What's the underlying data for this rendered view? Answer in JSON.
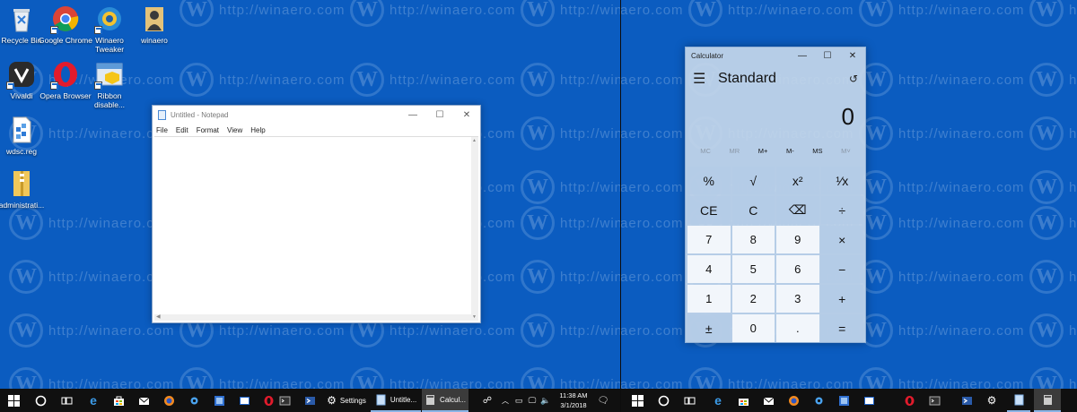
{
  "desktop_icons": [
    {
      "name": "recycle-bin",
      "label": "Recycle Bin"
    },
    {
      "name": "google-chrome",
      "label": "Google Chrome"
    },
    {
      "name": "winaero-tweaker",
      "label": "Winaero Tweaker"
    },
    {
      "name": "winaero",
      "label": "winaero"
    },
    {
      "name": "vivaldi",
      "label": "Vivaldi"
    },
    {
      "name": "opera-browser",
      "label": "Opera Browser"
    },
    {
      "name": "ribbon-disable",
      "label": "Ribbon disable..."
    },
    {
      "name": "wdsc-reg",
      "label": "wdsc.reg"
    },
    {
      "name": "administrati",
      "label": "administrati..."
    }
  ],
  "watermark": {
    "letter": "W",
    "text": "http://winaero.com"
  },
  "notepad": {
    "title": "Untitled - Notepad",
    "menu": [
      "File",
      "Edit",
      "Format",
      "View",
      "Help"
    ],
    "controls": {
      "minimize": "—",
      "maximize": "☐",
      "close": "✕"
    }
  },
  "calculator": {
    "title": "Calculator",
    "mode": "Standard",
    "display": "0",
    "controls": {
      "minimize": "—",
      "maximize": "☐",
      "close": "✕"
    },
    "menu_glyph": "☰",
    "history_glyph": "↺",
    "memory": [
      {
        "label": "MC",
        "enabled": false
      },
      {
        "label": "MR",
        "enabled": false
      },
      {
        "label": "M+",
        "enabled": true
      },
      {
        "label": "M-",
        "enabled": true
      },
      {
        "label": "MS",
        "enabled": true
      },
      {
        "label": "M˅",
        "enabled": false
      }
    ],
    "keys": [
      {
        "label": "%",
        "kind": "op"
      },
      {
        "label": "√",
        "kind": "op"
      },
      {
        "label": "x²",
        "kind": "op"
      },
      {
        "label": "¹⁄x",
        "kind": "op"
      },
      {
        "label": "CE",
        "kind": "op"
      },
      {
        "label": "C",
        "kind": "op"
      },
      {
        "label": "⌫",
        "kind": "op"
      },
      {
        "label": "÷",
        "kind": "op"
      },
      {
        "label": "7",
        "kind": "num"
      },
      {
        "label": "8",
        "kind": "num"
      },
      {
        "label": "9",
        "kind": "num"
      },
      {
        "label": "×",
        "kind": "op"
      },
      {
        "label": "4",
        "kind": "num"
      },
      {
        "label": "5",
        "kind": "num"
      },
      {
        "label": "6",
        "kind": "num"
      },
      {
        "label": "−",
        "kind": "op"
      },
      {
        "label": "1",
        "kind": "num"
      },
      {
        "label": "2",
        "kind": "num"
      },
      {
        "label": "3",
        "kind": "num"
      },
      {
        "label": "+",
        "kind": "op"
      },
      {
        "label": "±",
        "kind": "op"
      },
      {
        "label": "0",
        "kind": "num"
      },
      {
        "label": ".",
        "kind": "num"
      },
      {
        "label": "=",
        "kind": "op"
      }
    ]
  },
  "taskbar": {
    "settings_label": "Settings",
    "notepad_label": "Untitle...",
    "calculator_label": "Calcul...",
    "time": "11:38 AM",
    "date": "3/1/2018"
  },
  "colors": {
    "desktop": "#0b5cc0",
    "taskbar": "#101010",
    "accent": "#8ab4e6"
  }
}
